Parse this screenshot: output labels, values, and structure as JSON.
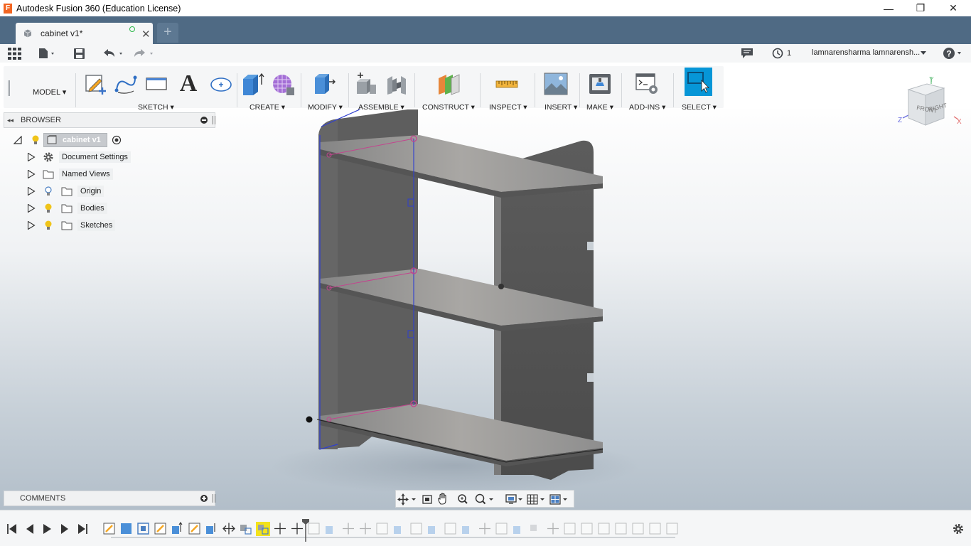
{
  "window": {
    "title": "Autodesk Fusion 360 (Education License)",
    "controls": {
      "minimize": "—",
      "restore": "❐",
      "close": "✕"
    }
  },
  "tabs": {
    "document": "cabinet v1*",
    "new_tab": "+"
  },
  "quick_access": {
    "jobs_count": "1",
    "user_name": "lamnarensharma lamnarensh..."
  },
  "toolbar": {
    "workspace": "MODEL",
    "groups": {
      "sketch": "SKETCH",
      "create": "CREATE",
      "modify": "MODIFY",
      "assemble": "ASSEMBLE",
      "construct": "CONSTRUCT",
      "inspect": "INSPECT",
      "insert": "INSERT",
      "make": "MAKE",
      "addins": "ADD-INS",
      "select": "SELECT"
    },
    "dropdown_caret": "▾",
    "text_tool_glyph": "A"
  },
  "browser": {
    "title": "BROWSER",
    "root": "cabinet v1",
    "items": [
      {
        "label": "Document Settings",
        "icon": "gear-icon"
      },
      {
        "label": "Named Views",
        "icon": "folder-icon"
      },
      {
        "label": "Origin",
        "icon": "folder-icon"
      },
      {
        "label": "Bodies",
        "icon": "folder-icon"
      },
      {
        "label": "Sketches",
        "icon": "folder-icon"
      }
    ]
  },
  "comments": {
    "title": "COMMENTS"
  },
  "viewcube": {
    "front": "FRONT",
    "right": "RIGHT",
    "axis_x": "X",
    "axis_y": "Y",
    "axis_z": "Z"
  },
  "colors": {
    "tab_bar": "#4f6a84",
    "panel": "#f5f6f7",
    "accent_blue": "#0696d7",
    "cabinet_gray": "#6b6b6b",
    "sketch_magenta": "#c2458e",
    "sketch_blue": "#2f3fd0"
  }
}
